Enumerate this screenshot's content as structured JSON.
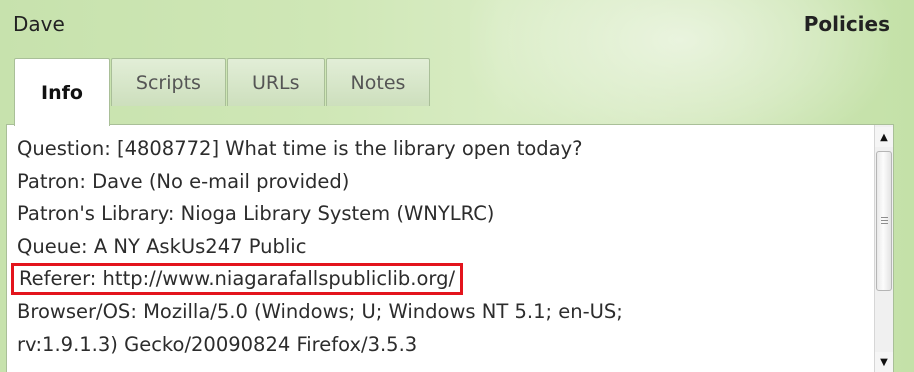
{
  "header": {
    "patron_name": "Dave",
    "policies_label": "Policies"
  },
  "tabs": [
    {
      "label": "Info",
      "active": true
    },
    {
      "label": "Scripts",
      "active": false
    },
    {
      "label": "URLs",
      "active": false
    },
    {
      "label": "Notes",
      "active": false
    }
  ],
  "info": {
    "question": "Question: [4808772] What time is the library open today?",
    "patron": "Patron: Dave (No e-mail provided)",
    "patron_library": "Patron's Library: Nioga Library System (WNYLRC)",
    "queue": "Queue: A NY AskUs247 Public",
    "referer": "Referer: http://www.niagarafallspubliclib.org/",
    "browser_os_line1": "Browser/OS: Mozilla/5.0 (Windows; U; Windows NT 5.1; en-US;",
    "browser_os_line2": "rv:1.9.1.3) Gecko/20090824 Firefox/3.5.3"
  },
  "colors": {
    "highlight_border": "#e3141c",
    "header_background": "#cfe7b6"
  },
  "icons": {
    "scroll_up": "up-arrow-icon",
    "scroll_down": "down-arrow-icon",
    "scroll_grip": "grip-icon"
  }
}
